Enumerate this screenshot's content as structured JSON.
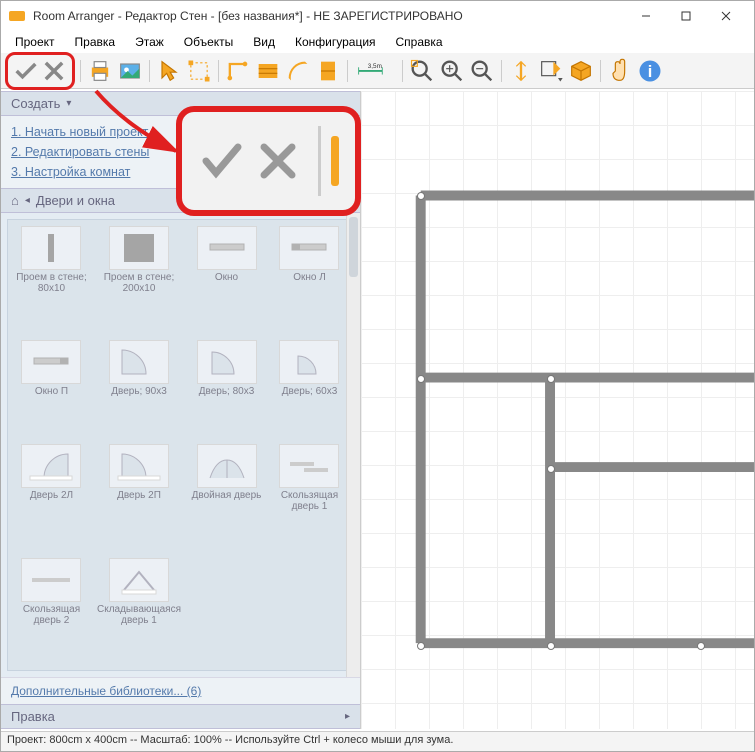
{
  "title": "Room Arranger - Редактор Стен - [без названия*] - НЕ ЗАРЕГИСТРИРОВАНО",
  "menu": {
    "items": [
      "Проект",
      "Правка",
      "Этаж",
      "Объекты",
      "Вид",
      "Конфигурация",
      "Справка"
    ]
  },
  "toolbar": {
    "ok": "ok-icon",
    "cancel": "cancel-icon",
    "measure_label": "3,5m"
  },
  "sidebar": {
    "create_hdr": "Создать",
    "steps": [
      "1. Начать новый проект",
      "2. Редактировать стены",
      "3. Настройка комнат"
    ],
    "doors_hdr": "Двери и окна",
    "items": [
      {
        "label": "Проем в стене; 80x10"
      },
      {
        "label": "Проем в стене; 200x10"
      },
      {
        "label": "Окно"
      },
      {
        "label": "Окно Л"
      },
      {
        "label": "Окно П"
      },
      {
        "label": "Дверь; 90x3"
      },
      {
        "label": "Дверь; 80x3"
      },
      {
        "label": "Дверь; 60x3"
      },
      {
        "label": "Дверь 2Л"
      },
      {
        "label": "Дверь 2П"
      },
      {
        "label": "Двойная дверь"
      },
      {
        "label": "Скользящая дверь 1"
      },
      {
        "label": "Скользящая дверь 2"
      },
      {
        "label": "Складывающаяся дверь 1"
      }
    ],
    "extra_libs": "Дополнительные библиотеки... (6)",
    "edit_hdr": "Правка"
  },
  "statusbar": "Проект: 800cm x 400cm -- Масштаб: 100% -- Используйте Ctrl + колесо мыши для зума."
}
